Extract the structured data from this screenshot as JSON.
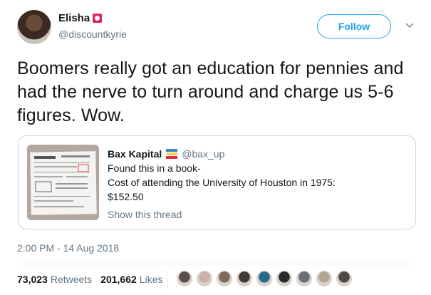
{
  "author": {
    "name": "Elisha",
    "handle": "@discountkyrie"
  },
  "follow_label": "Follow",
  "tweet_text": "Boomers really got an education for pennies and had the nerve to turn around and charge us 5-6 figures. Wow.",
  "quote": {
    "name": "Bax Kapital",
    "handle": "@bax_up",
    "lines": [
      "Found this in a book-",
      "Cost of attending the University of Houston in 1975:",
      "$152.50"
    ],
    "show_thread": "Show this thread"
  },
  "timestamp": "2:00 PM - 14 Aug 2018",
  "stats": {
    "retweets_count": "73,023",
    "retweets_label": "Retweets",
    "likes_count": "201,662",
    "likes_label": "Likes"
  },
  "colors": {
    "accent": "#1da1f2",
    "muted": "#657786",
    "text": "#14171a"
  },
  "liker_avatars": [
    "#5a4f4c",
    "#c9b2a6",
    "#7c6a5a",
    "#3f3a38",
    "#2b6a8a",
    "#2a2a2a",
    "#6b6f78",
    "#b7a594",
    "#4d4a4a"
  ]
}
